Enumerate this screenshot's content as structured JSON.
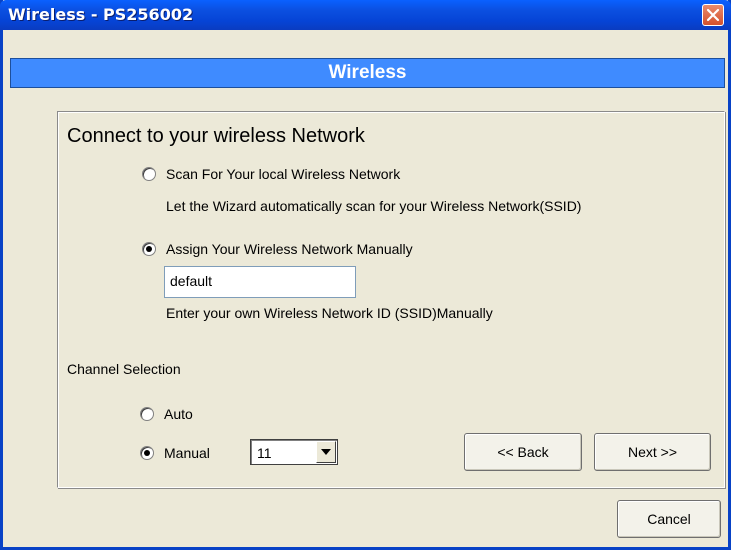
{
  "window": {
    "title": "Wireless - PS256002"
  },
  "banner": {
    "title": "Wireless"
  },
  "main": {
    "heading": "Connect to your wireless Network",
    "scan_option": {
      "label": "Scan For Your local Wireless Network",
      "description": "Let the Wizard automatically scan for your Wireless Network(SSID)",
      "selected": false
    },
    "manual_option": {
      "label": "Assign Your Wireless Network Manually",
      "selected": true,
      "ssid_value": "default",
      "description": "Enter your own Wireless Network ID (SSID)Manually"
    },
    "channel": {
      "label": "Channel Selection",
      "auto_label": "Auto",
      "manual_label": "Manual",
      "selected": "Manual",
      "value": "11"
    }
  },
  "buttons": {
    "back": "<< Back",
    "next": "Next >>",
    "cancel": "Cancel"
  },
  "colors": {
    "titlebar": "#0a4fe0",
    "banner": "#3f8bff",
    "background": "#ece9d8",
    "close": "#d4512c"
  },
  "icons": {
    "close": "close-icon",
    "dropdown": "chevron-down-icon"
  }
}
